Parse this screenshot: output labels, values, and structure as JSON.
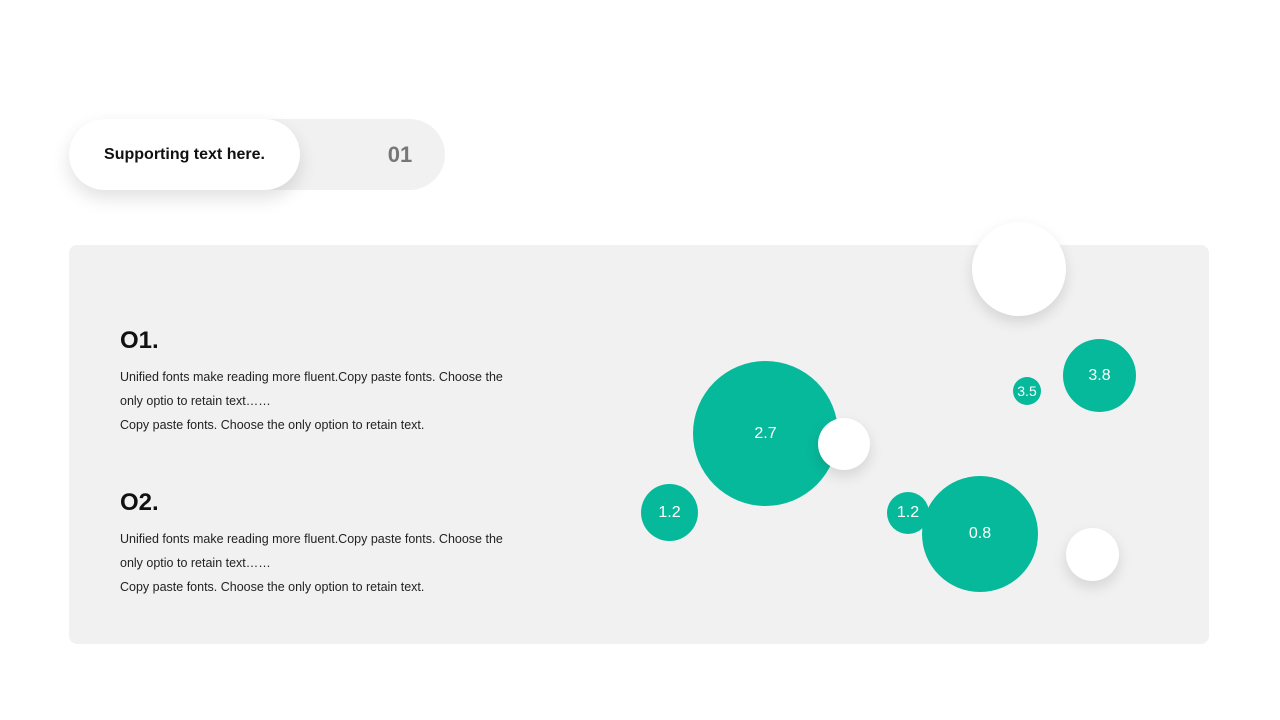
{
  "header": {
    "pill_text": "Supporting text here.",
    "pill_number": "01"
  },
  "sections": [
    {
      "heading": "O1.",
      "lines": [
        "Unified fonts make reading more fluent.Copy paste fonts. Choose the",
        "only optio to retain text……",
        "Copy paste  fonts. Choose the only option to retain text."
      ]
    },
    {
      "heading": "O2.",
      "lines": [
        "Unified fonts make reading more fluent.Copy paste fonts. Choose the",
        "only optio to retain text……",
        "Copy paste  fonts. Choose the only option to retain text."
      ]
    }
  ],
  "bubbles": [
    {
      "label": "2.7",
      "value": 2.7
    },
    {
      "label": "1.2",
      "value": 1.2
    },
    {
      "label": "1.2",
      "value": 1.2
    },
    {
      "label": "0.8",
      "value": 0.8
    },
    {
      "label": "3.5",
      "value": 3.5
    },
    {
      "label": "3.8",
      "value": 3.8
    }
  ],
  "colors": {
    "accent": "#07b99b",
    "panel": "#f1f1f1",
    "text": "#111111"
  }
}
